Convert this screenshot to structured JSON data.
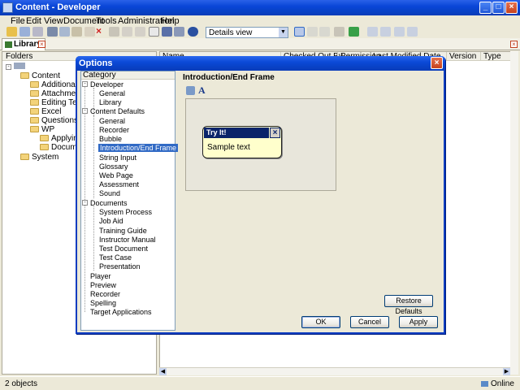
{
  "app": {
    "title": "Content - Developer"
  },
  "menu": [
    "File",
    "Edit",
    "View",
    "Document",
    "Tools",
    "Administration",
    "Help"
  ],
  "toolbar": {
    "view_select": "Details view"
  },
  "library_tab": {
    "label": "Library"
  },
  "folders": {
    "header": "Folders",
    "items": [
      "Content",
      "Additional Top",
      "Attachments",
      "Editing Techni",
      "Excel",
      "Questions and",
      "WP",
      "Applying F",
      "Document",
      "System"
    ]
  },
  "list": {
    "columns": [
      "Name",
      "Checked Out By",
      "Permission",
      "Last Modified Date",
      "Version",
      "Type"
    ]
  },
  "status": {
    "left": "2 objects",
    "right": "Online"
  },
  "dialog": {
    "title": "Options",
    "category_header": "Category",
    "categories": {
      "developer": "Developer",
      "dev_children": [
        "General",
        "Library"
      ],
      "content_defaults": "Content Defaults",
      "cd_children": [
        "General",
        "Recorder",
        "Bubble",
        "Introduction/End Frame",
        "String Input",
        "Glossary",
        "Web Page",
        "Assessment",
        "Sound"
      ],
      "documents": "Documents",
      "doc_children": [
        "System Process",
        "Job Aid",
        "Training Guide",
        "Instructor Manual",
        "Test Document",
        "Test Case",
        "Presentation"
      ],
      "top_level": [
        "Player",
        "Preview",
        "Recorder",
        "Spelling",
        "Target Applications"
      ]
    },
    "section_title": "Introduction/End Frame",
    "bubble": {
      "title": "Try It!",
      "text": "Sample text"
    },
    "buttons": {
      "restore": "Restore Defaults",
      "ok": "OK",
      "cancel": "Cancel",
      "apply": "Apply"
    }
  }
}
